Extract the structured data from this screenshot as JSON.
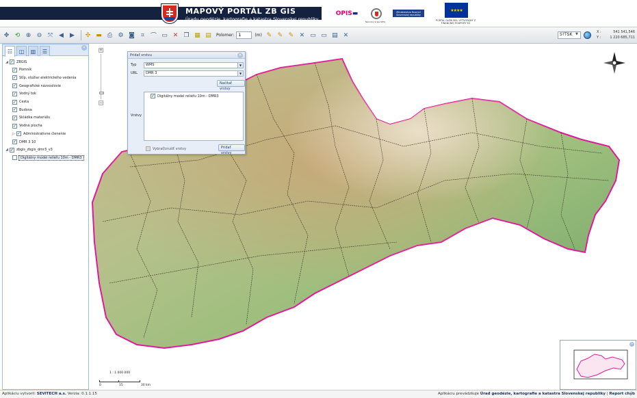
{
  "banner": {
    "title": "MAPOVÝ PORTÁL ZB GIS",
    "subtitle": "Úradu geodézie, kartografie a katastra Slovenskej republiky",
    "logo_opis_a": "OPIS",
    "logo_seal_caption": "Národný kraje OPIS",
    "logo_mv": "Ministerstvo financií Slovenskej republiky",
    "eu_caption": "PORTÁL GURK BOL VYTVORENÝ Z FINANČNEJ PODPORY EÚ"
  },
  "toolbar": {
    "polomer_label": "Polomer:",
    "polomer_value": "1",
    "polomer_unit": "(m)"
  },
  "crs": {
    "value": "S?TSK"
  },
  "coords": {
    "x_label": "X :",
    "x_value": "541 541,546",
    "y_label": "Y :",
    "y_value": "1 220 685,711"
  },
  "sidebar": {
    "tree": [
      {
        "label": "ZBGIS",
        "checked": true,
        "level": 0,
        "expanded": true
      },
      {
        "label": "Pomník",
        "checked": true,
        "level": 1
      },
      {
        "label": "Stĺp, stožiar elektrického vedenia",
        "checked": true,
        "level": 1
      },
      {
        "label": "Geografické názvoslovie",
        "checked": true,
        "level": 1
      },
      {
        "label": "Vodný tok",
        "checked": true,
        "level": 1
      },
      {
        "label": "Cesta",
        "checked": true,
        "level": 1
      },
      {
        "label": "Budova",
        "checked": true,
        "level": 1
      },
      {
        "label": "Skládka materiálu",
        "checked": true,
        "level": 1
      },
      {
        "label": "Vodná plocha",
        "checked": true,
        "level": 1
      },
      {
        "label": "Administratívne členenie",
        "checked": true,
        "level": 1,
        "collapsed": true
      },
      {
        "label": "DMR 3 10",
        "checked": true,
        "level": 1
      },
      {
        "label": "zbgis_zbgis_dmr3_v3",
        "checked": true,
        "level": 0,
        "expanded": true
      },
      {
        "label": "Digitálny model reliéfu 10m - DMR3",
        "checked": false,
        "level": 1,
        "selected": true
      }
    ]
  },
  "dialog": {
    "title": "Pridať vrstvu",
    "type_label": "Typ",
    "type_value": "WMS",
    "url_label": "URL",
    "url_value": "DMR 3",
    "load_button": "Načítať vrstvy",
    "layers_label": "Vrstvy",
    "layer_item": "Digitálny model reliéfu 10m - DMR3",
    "select_all": "Vybrať/zrušiť vrstvy",
    "add_button": "Pridať vrstvy"
  },
  "scale": {
    "ratio": "1 : 1 000 000",
    "ticks": [
      "0",
      "15",
      "30 km"
    ]
  },
  "status": {
    "left_prefix": "Aplikáciu vytvoril:",
    "left_company": "SEVITECH a.s.",
    "left_version": "Verzia: 0.1.1.15",
    "right_prefix": "Aplikáciu prevádzkuje",
    "right_org": "Úrad geodézie, kartografie a katastra Slovenskej republiky",
    "right_link": "Report chýb"
  },
  "colors": {
    "banner": "#14213f",
    "border": "#e0199a",
    "accent": "#99bbe8"
  }
}
